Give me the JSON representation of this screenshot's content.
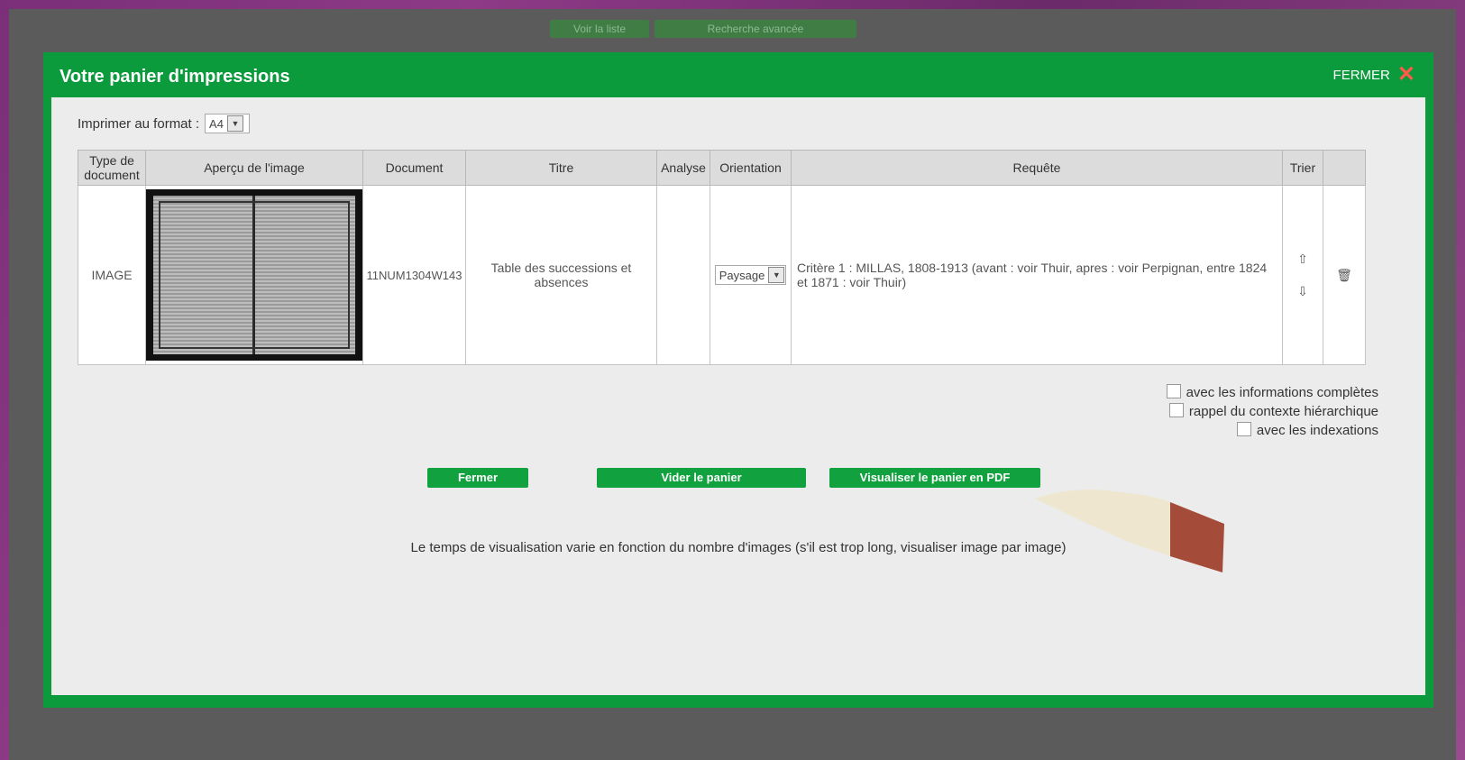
{
  "background": {
    "button_1": "Voir la liste",
    "button_2": "Recherche avancée"
  },
  "modal": {
    "title": "Votre panier d'impressions",
    "close_label": "FERMER",
    "close_icon": "close-x-icon",
    "accent_color": "#0b9a3c",
    "format": {
      "label": "Imprimer au format :",
      "value": "A4"
    },
    "table": {
      "headers": [
        "Type de document",
        "Aperçu de l'image",
        "Document",
        "Titre",
        "Analyse",
        "Orientation",
        "Requête",
        "Trier",
        ""
      ],
      "rows": [
        {
          "type": "IMAGE",
          "document": "11NUM1304W143",
          "titre": "Table des successions et absences",
          "analyse": "",
          "orientation": "Paysage",
          "requete": "Critère 1 : MILLAS, 1808-1913 (avant : voir Thuir, apres : voir Perpignan, entre 1824 et 1871 : voir Thuir)"
        }
      ]
    },
    "options": [
      "avec les informations complètes",
      "rappel du contexte hiérarchique",
      "avec les indexations"
    ],
    "buttons": {
      "close": "Fermer",
      "empty": "Vider le panier",
      "pdf": "Visualiser le panier en PDF"
    },
    "note": "Le temps de visualisation varie en fonction du nombre d'images (s'il est trop long, visualiser image par image)"
  }
}
